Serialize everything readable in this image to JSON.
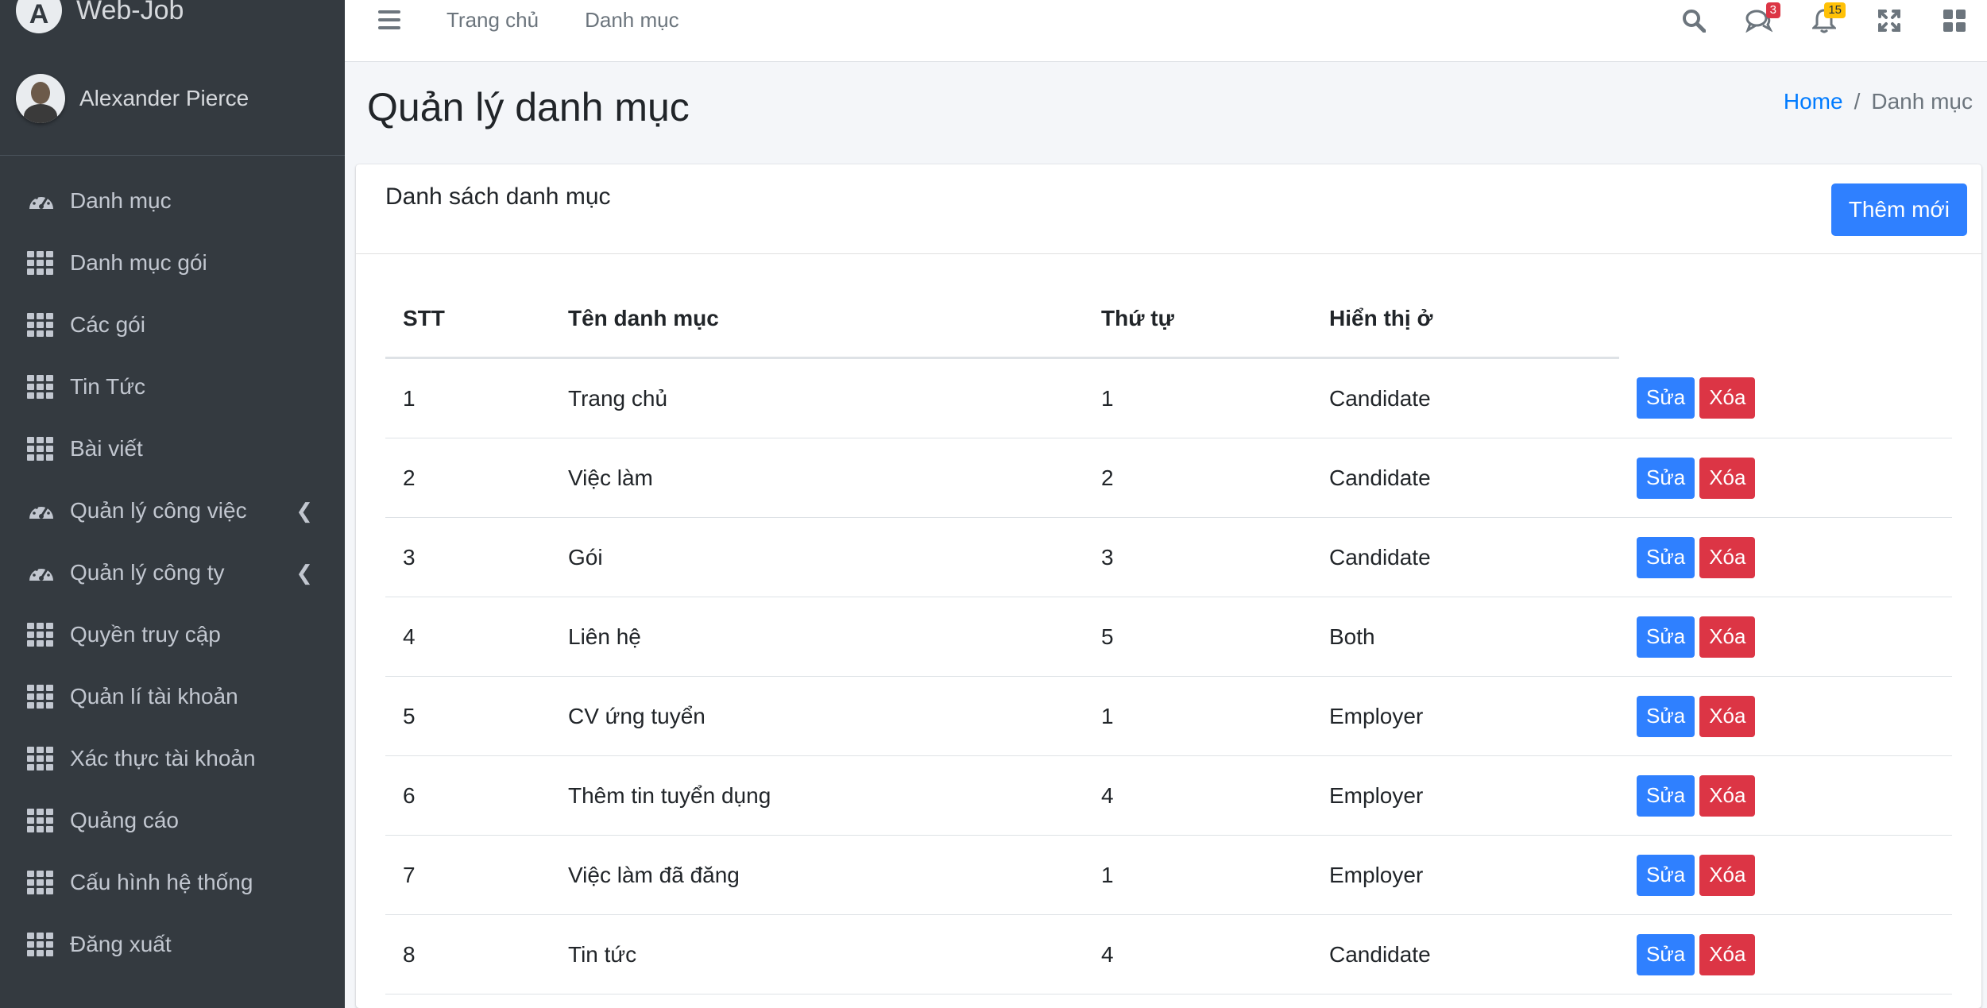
{
  "brand": {
    "name": "Web-Job",
    "logo_letter": "A"
  },
  "user": {
    "name": "Alexander Pierce"
  },
  "sidebar": {
    "items": [
      {
        "label": "Danh mục",
        "icon": "gauge-icon",
        "chevron": false
      },
      {
        "label": "Danh mục gói",
        "icon": "grid-icon",
        "chevron": false
      },
      {
        "label": "Các gói",
        "icon": "grid-icon",
        "chevron": false
      },
      {
        "label": "Tin Tức",
        "icon": "grid-icon",
        "chevron": false
      },
      {
        "label": "Bài viết",
        "icon": "grid-icon",
        "chevron": false
      },
      {
        "label": "Quản lý công việc",
        "icon": "gauge-icon",
        "chevron": true
      },
      {
        "label": "Quản lý công ty",
        "icon": "gauge-icon",
        "chevron": true
      },
      {
        "label": "Quyền truy cập",
        "icon": "grid-icon",
        "chevron": false
      },
      {
        "label": "Quản lí tài khoản",
        "icon": "grid-icon",
        "chevron": false
      },
      {
        "label": "Xác thực tài khoản",
        "icon": "grid-icon",
        "chevron": false
      },
      {
        "label": "Quảng cáo",
        "icon": "grid-icon",
        "chevron": false
      },
      {
        "label": "Cấu hình hệ thống",
        "icon": "grid-icon",
        "chevron": false
      },
      {
        "label": "Đăng xuất",
        "icon": "grid-icon",
        "chevron": false
      }
    ]
  },
  "navbar": {
    "links": [
      "Trang chủ",
      "Danh mục"
    ],
    "messages_count": "3",
    "notifications_count": "15"
  },
  "header": {
    "title": "Quản lý danh mục",
    "breadcrumb_home": "Home",
    "breadcrumb_sep": "/",
    "breadcrumb_current": "Danh mục"
  },
  "card": {
    "title": "Danh sách danh mục",
    "add_label": "Thêm mới",
    "columns": [
      "STT",
      "Tên danh mục",
      "Thứ tự",
      "Hiển thị ở",
      ""
    ],
    "edit_label": "Sửa",
    "delete_label": "Xóa",
    "rows": [
      {
        "stt": "1",
        "name": "Trang chủ",
        "order": "1",
        "display": "Candidate"
      },
      {
        "stt": "2",
        "name": "Việc làm",
        "order": "2",
        "display": "Candidate"
      },
      {
        "stt": "3",
        "name": "Gói",
        "order": "3",
        "display": "Candidate"
      },
      {
        "stt": "4",
        "name": "Liên hệ",
        "order": "5",
        "display": "Both"
      },
      {
        "stt": "5",
        "name": "CV ứng tuyển",
        "order": "1",
        "display": "Employer"
      },
      {
        "stt": "6",
        "name": "Thêm tin tuyển dụng",
        "order": "4",
        "display": "Employer"
      },
      {
        "stt": "7",
        "name": "Việc làm đã đăng",
        "order": "1",
        "display": "Employer"
      },
      {
        "stt": "8",
        "name": "Tin tức",
        "order": "4",
        "display": "Candidate"
      }
    ]
  },
  "colors": {
    "sidebar_bg": "#343a40",
    "primary": "#2f80ff",
    "danger": "#dc3545",
    "warning": "#ffc107"
  }
}
